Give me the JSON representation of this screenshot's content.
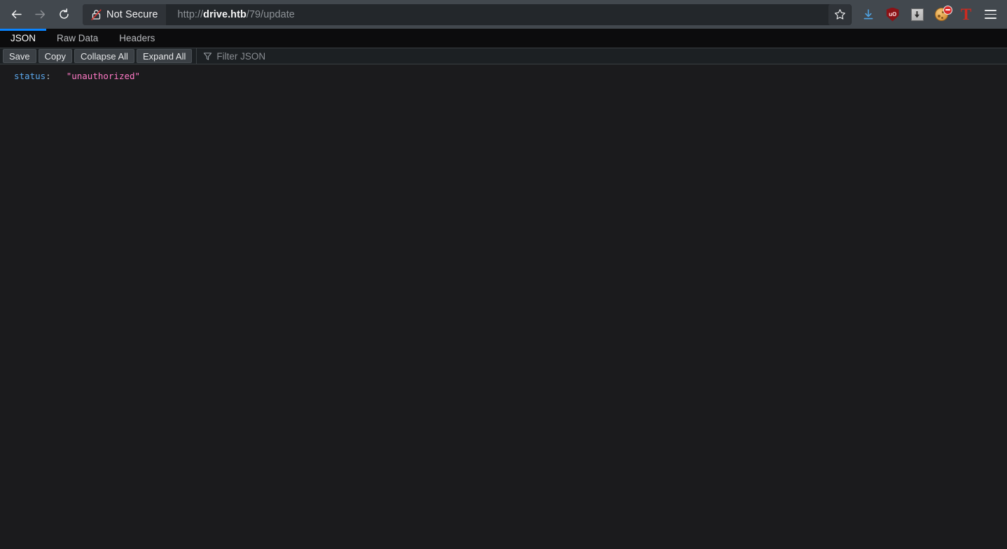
{
  "browser": {
    "nav": {
      "back_icon": "arrow-left-icon",
      "forward_icon": "arrow-right-icon",
      "reload_icon": "reload-icon"
    },
    "urlbar": {
      "security_label": "Not Secure",
      "security_icon": "lock-crossed-icon",
      "url_scheme": "http://",
      "url_host": "drive.htb",
      "url_path": "/79/update",
      "full_url": "http://drive.htb/79/update",
      "bookmark_icon": "star-icon"
    },
    "toolbar_icons": [
      {
        "name": "downloads-icon",
        "label": "Downloads"
      },
      {
        "name": "ublock-origin-icon",
        "label": "uO"
      },
      {
        "name": "extension-gray-icon",
        "label": "Extension"
      },
      {
        "name": "cookie-blocker-icon",
        "label": "Cookie Blocker"
      },
      {
        "name": "tampermonkey-icon",
        "label": "T"
      },
      {
        "name": "hamburger-menu-icon",
        "label": "Open application menu"
      }
    ]
  },
  "json_viewer": {
    "tabs": [
      {
        "label": "JSON",
        "active": true
      },
      {
        "label": "Raw Data",
        "active": false
      },
      {
        "label": "Headers",
        "active": false
      }
    ],
    "toolbar": {
      "save_label": "Save",
      "copy_label": "Copy",
      "collapse_all_label": "Collapse All",
      "expand_all_label": "Expand All",
      "filter_icon": "funnel-icon",
      "filter_placeholder": "Filter JSON"
    },
    "content": {
      "rows": [
        {
          "key": "status",
          "colon": ":",
          "value": "\"unauthorized\""
        }
      ]
    }
  },
  "colors": {
    "chrome_bg": "#42484e",
    "urlbar_bg": "#23272b",
    "tabbar_bg": "#0c0c0d",
    "toolbar_bg": "#1c2023",
    "content_bg": "#1b1b1d",
    "accent_blue": "#0a84ff",
    "json_key": "#5ba8ed",
    "json_string": "#ff79c6"
  }
}
